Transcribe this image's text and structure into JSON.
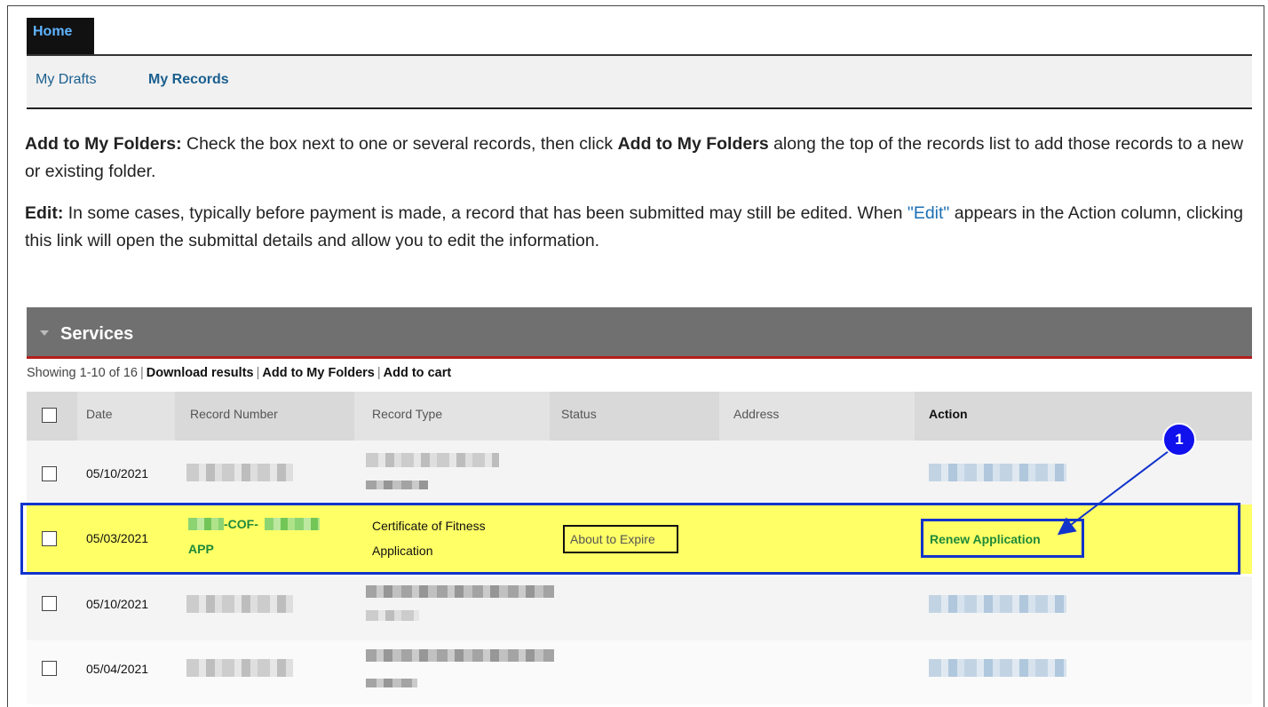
{
  "nav": {
    "home_tab": "Home",
    "sub_items": [
      "My Drafts",
      "My Records"
    ]
  },
  "help": {
    "add_folders_label": "Add to My Folders:",
    "add_folders_text_1": " Check the box next to one or several records, then click ",
    "add_folders_bold": "Add to My Folders",
    "add_folders_text_2": " along the top of the records list to add those records to a new or existing folder.",
    "edit_label": "Edit:",
    "edit_text_1": " In some cases, typically before payment is made, a record that has been submitted may still be edited. When ",
    "edit_link": "\"Edit\"",
    "edit_text_2": " appears in the Action column, clicking this link will open the submittal details and allow you to edit the information."
  },
  "services": {
    "title": "Services",
    "showing": "Showing 1-10 of 16",
    "actions": [
      "Download results",
      "Add to My Folders",
      "Add to cart"
    ]
  },
  "table": {
    "headers": [
      "Date",
      "Record Number",
      "Record Type",
      "Status",
      "Address",
      "Action"
    ],
    "rows": [
      {
        "date": "05/10/2021",
        "record": "",
        "type": "",
        "status": "",
        "action": ""
      },
      {
        "date": "05/03/2021",
        "record_line1": "-COF-",
        "record_line2": "APP",
        "type_line1": "Certificate of Fitness",
        "type_line2": "Application",
        "status": "About to Expire",
        "action": "Renew Application"
      },
      {
        "date": "05/10/2021",
        "record": "",
        "type": "",
        "status": "",
        "action": ""
      },
      {
        "date": "05/04/2021",
        "record": "",
        "type": "",
        "status": "",
        "action": ""
      }
    ]
  },
  "callout": {
    "number": "1"
  },
  "colors": {
    "highlight": "#ffff66",
    "annotation": "#1133cc",
    "link": "#1c70b5",
    "record_green": "#1f8a3a"
  }
}
